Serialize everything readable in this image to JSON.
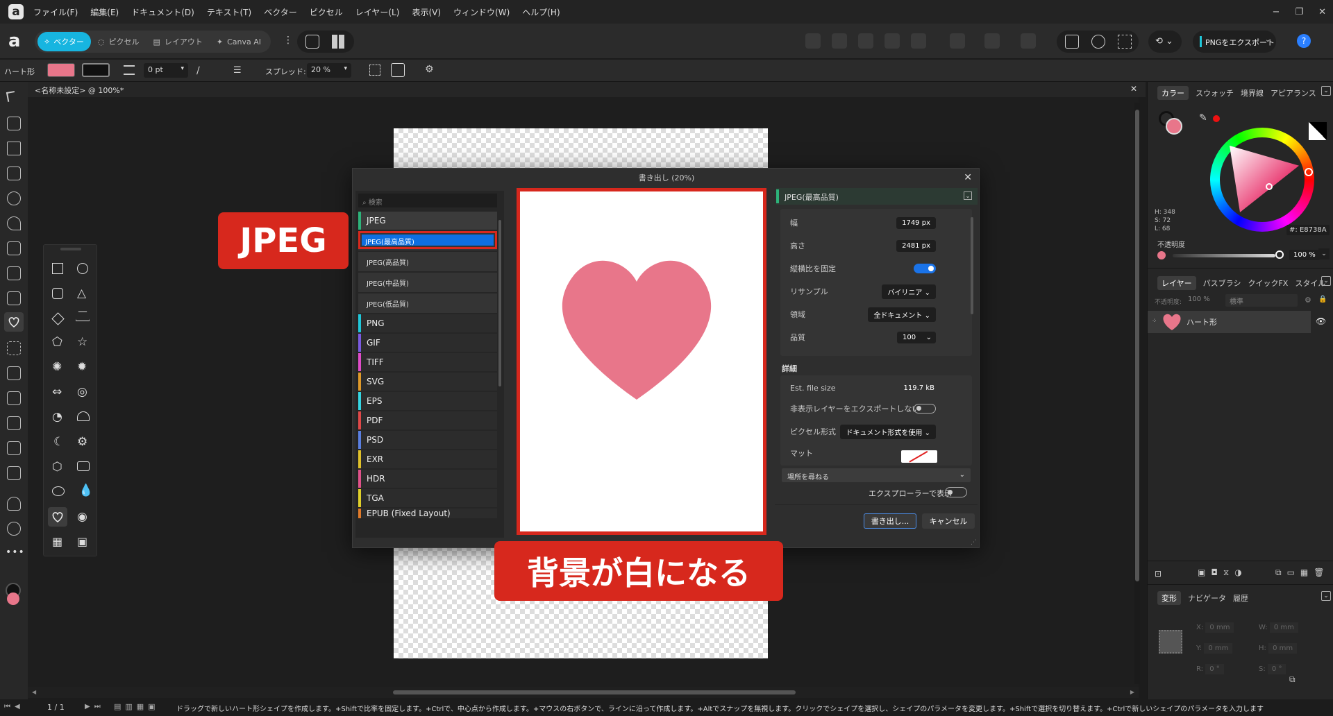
{
  "app": {
    "logo": "a",
    "menus": [
      "ファイル(F)",
      "編集(E)",
      "ドキュメント(D)",
      "テキスト(T)",
      "ベクター",
      "ピクセル",
      "レイヤー(L)",
      "表示(V)",
      "ウィンドウ(W)",
      "ヘルプ(H)"
    ],
    "window_controls": [
      "−",
      "❐",
      "✕"
    ]
  },
  "toolbar": {
    "modes": [
      "ベクター",
      "ピクセル",
      "レイアウト",
      "Canva AI"
    ],
    "export_label": "PNGをエクスポート",
    "help": "?"
  },
  "context": {
    "shape_name": "ハート形",
    "fill_color": "#E8768A",
    "stroke_width": "0 pt",
    "spread_label": "スプレッド:",
    "spread_value": "20 %"
  },
  "document": {
    "tab_title": "<名称未設定> @ 100%*"
  },
  "dialog": {
    "title": "書き出し (20%)",
    "search_placeholder": "検索",
    "formats": [
      {
        "name": "JPEG",
        "color": "#2db37a"
      },
      {
        "name": "PNG",
        "color": "#20c7d9"
      },
      {
        "name": "GIF",
        "color": "#7a5ae0"
      },
      {
        "name": "TIFF",
        "color": "#e04cc8"
      },
      {
        "name": "SVG",
        "color": "#e09a2a"
      },
      {
        "name": "EPS",
        "color": "#35d6e3"
      },
      {
        "name": "PDF",
        "color": "#e04848"
      },
      {
        "name": "PSD",
        "color": "#5a7fe0"
      },
      {
        "name": "EXR",
        "color": "#e0c12a"
      },
      {
        "name": "HDR",
        "color": "#e0528a"
      },
      {
        "name": "TGA",
        "color": "#e0d02a"
      },
      {
        "name": "EPUB (Fixed Layout)",
        "color": "#e07a2a"
      }
    ],
    "jpeg_presets": [
      "JPEG(最高品質)",
      "JPEG(高品質)",
      "JPEG(中品質)",
      "JPEG(低品質)"
    ],
    "preset_selected": "JPEG(最高品質)",
    "props": {
      "width_label": "幅",
      "width": "1749 px",
      "height_label": "高さ",
      "height": "2481 px",
      "lock_label": "縦横比を固定",
      "resample_label": "リサンプル",
      "resample": "バイリニア",
      "area_label": "領域",
      "area": "全ドキュメント",
      "quality_label": "品質",
      "quality": "100"
    },
    "details": {
      "heading": "詳細",
      "filesize_label": "Est. file size",
      "filesize": "119.7 kB",
      "hidden_label": "非表示レイヤーをエクスポートしない",
      "pixel_label": "ピクセル形式",
      "pixel": "ドキュメント形式を使用",
      "matte_label": "マット"
    },
    "location": "場所を尋ねる",
    "explorer_label": "エクスプローラーで表示",
    "export_btn": "書き出し...",
    "cancel_btn": "キャンセル"
  },
  "callouts": {
    "jpeg": "JPEG",
    "white_bg": "背景が白になる"
  },
  "right_panel": {
    "color_tabs": [
      "カラー",
      "スウォッチ",
      "境界線",
      "アピアランス"
    ],
    "hsl": [
      "H: 348",
      "S: 72",
      "L: 68"
    ],
    "hex": "E8738A",
    "opacity_label": "不透明度",
    "opacity": "100 %",
    "layer_tabs": [
      "レイヤー",
      "パスブラシ",
      "クイックFX",
      "スタイル"
    ],
    "layer_opacity_label": "不透明度:",
    "layer_opacity": "100 %",
    "blend": "標準",
    "layer_name": "ハート形",
    "transform_tabs": [
      "変形",
      "ナビゲータ",
      "履歴"
    ],
    "transform": {
      "x": "0 mm",
      "y": "0 mm",
      "w": "0 mm",
      "h": "0 mm",
      "r": "0 °",
      "s": "0 °"
    }
  },
  "status": {
    "page": "1 / 1",
    "message": "ドラッグで新しいハート形シェイプを作成します。+Shiftで比率を固定します。+Ctrlで、中心点から作成します。+マウスの右ボタンで、ラインに沿って作成します。+Altでスナップを無視します。クリックでシェイプを選択し、シェイプのパラメータを変更します。+Shiftで選択を切り替えます。+Ctrlで新しいシェイプのパラメータを入力します"
  }
}
